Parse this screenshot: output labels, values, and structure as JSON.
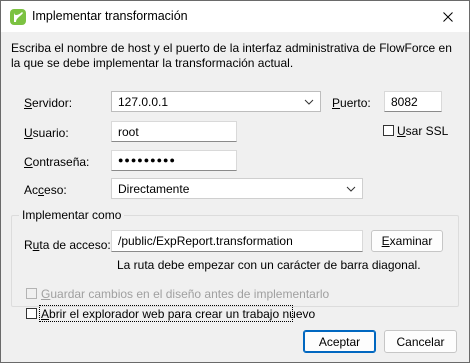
{
  "window": {
    "title": "Implementar transformación",
    "icon": "flowforce-app-icon",
    "accent_color": "#0067c0"
  },
  "description": "Escriba el nombre de host y el puerto de la interfaz administrativa de FlowForce en la que se debe implementar la transformación actual.",
  "form": {
    "server_label_u": "S",
    "server_label_rest": "ervidor:",
    "server_value": "127.0.0.1",
    "port_label_u": "P",
    "port_label_rest": "uerto:",
    "port_value": "8082",
    "ssl_label_u": "U",
    "ssl_label_rest": "sar SSL",
    "ssl_checked": false,
    "user_label_u": "U",
    "user_label_rest": "suario:",
    "user_value": "root",
    "password_label_u": "C",
    "password_label_rest": "ontraseña:",
    "password_value": "●●●●●●●●●",
    "access_label_pre": "Ac",
    "access_label_u": "c",
    "access_label_rest": "eso:",
    "access_value": "Directamente"
  },
  "deploy_group": {
    "title": "Implementar como",
    "path_label_pre": "R",
    "path_label_u": "u",
    "path_label_rest": "ta de acceso:",
    "path_value": "/public/ExpReport.transformation",
    "browse_label_u": "E",
    "browse_label_rest": "xaminar",
    "hint": "La ruta debe empezar con un carácter de barra diagonal."
  },
  "options": {
    "save_changes_pre": "",
    "save_changes_u": "G",
    "save_changes_rest": "uardar cambios en el diseño antes de implementarlo",
    "save_changes_enabled": false,
    "open_browser_u": "A",
    "open_browser_rest": "brir el explorador web para crear un trabajo nuevo",
    "open_browser_checked": false
  },
  "buttons": {
    "ok": "Aceptar",
    "cancel": "Cancelar"
  }
}
